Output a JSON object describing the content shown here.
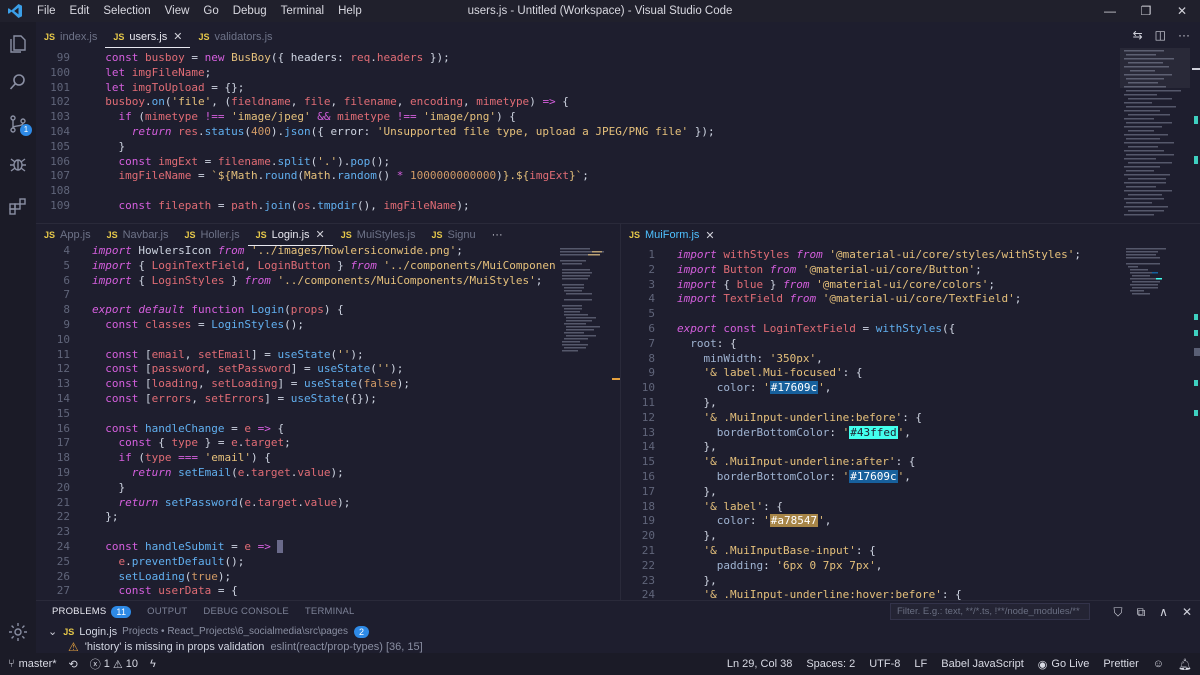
{
  "window": {
    "title": "users.js - Untitled (Workspace) - Visual Studio Code",
    "menu": [
      "File",
      "Edit",
      "Selection",
      "View",
      "Go",
      "Debug",
      "Terminal",
      "Help"
    ]
  },
  "activity_bar": {
    "icons": [
      "files-icon",
      "search-icon",
      "source-control-icon",
      "debug-icon",
      "extensions-icon",
      "settings-gear-icon"
    ],
    "scm_badge": "1"
  },
  "top_editor": {
    "tabs": [
      {
        "label": "index.js",
        "active": false
      },
      {
        "label": "users.js",
        "active": true
      },
      {
        "label": "validators.js",
        "active": false
      }
    ],
    "lines": [
      {
        "n": "99",
        "html": "  <span class='kw'>const</span> <span class='var'>busboy</span> <span class='plain'>=</span> <span class='kw'>new</span> <span class='cls'>BusBoy</span><span class='plain'>({ headers: </span><span class='var'>req</span><span class='plain'>.</span><span class='var'>headers</span><span class='plain'> });</span>"
      },
      {
        "n": "100",
        "html": "  <span class='kw'>let</span> <span class='var'>imgFileName</span><span class='plain'>;</span>"
      },
      {
        "n": "101",
        "html": "  <span class='kw'>let</span> <span class='var'>imgToUpload</span> <span class='plain'>= {};</span>"
      },
      {
        "n": "102",
        "html": "  <span class='var'>busboy</span><span class='plain'>.</span><span class='fn'>on</span><span class='plain'>(</span><span class='str'>'file'</span><span class='plain'>, (</span><span class='var'>fieldname</span><span class='plain'>, </span><span class='var'>file</span><span class='plain'>, </span><span class='var'>filename</span><span class='plain'>, </span><span class='var'>encoding</span><span class='plain'>, </span><span class='var'>mimetype</span><span class='plain'>) </span><span class='kw'>=></span><span class='plain'> {</span>"
      },
      {
        "n": "103",
        "html": "    <span class='kw'>if</span><span class='plain'> (</span><span class='var'>mimetype</span> <span class='kw'>!==</span> <span class='str'>'image/jpeg'</span> <span class='kw'>&&</span> <span class='var'>mimetype</span> <span class='kw'>!==</span> <span class='str'>'image/png'</span><span class='plain'>) {</span>"
      },
      {
        "n": "104",
        "html": "      <span class='kw ital'>return</span> <span class='var'>res</span><span class='plain'>.</span><span class='fn'>status</span><span class='plain'>(</span><span class='num'>400</span><span class='plain'>).</span><span class='fn'>json</span><span class='plain'>({ error: </span><span class='str'>'Unsupported file type, upload a JPEG/PNG file'</span><span class='plain'> });</span>"
      },
      {
        "n": "105",
        "html": "    <span class='plain'>}</span>"
      },
      {
        "n": "106",
        "html": "    <span class='kw'>const</span> <span class='var'>imgExt</span> <span class='plain'>=</span> <span class='var'>filename</span><span class='plain'>.</span><span class='fn'>split</span><span class='plain'>(</span><span class='str'>'.'</span><span class='plain'>).</span><span class='fn'>pop</span><span class='plain'>();</span>"
      },
      {
        "n": "107",
        "html": "    <span class='var'>imgFileName</span> <span class='plain'>=</span> <span class='str'>`${</span><span class='cls'>Math</span><span class='plain'>.</span><span class='fn'>round</span><span class='plain'>(</span><span class='cls'>Math</span><span class='plain'>.</span><span class='fn'>random</span><span class='plain'>() </span><span class='kw'>*</span> <span class='num'>1000000000000</span><span class='plain'>)</span><span class='str'>}.${</span><span class='var'>imgExt</span><span class='str'>}`</span><span class='plain'>;</span>"
      },
      {
        "n": "108",
        "html": ""
      },
      {
        "n": "109",
        "html": "    <span class='kw'>const</span> <span class='var'>filepath</span> <span class='plain'>=</span> <span class='var'>path</span><span class='plain'>.</span><span class='fn'>join</span><span class='plain'>(</span><span class='var'>os</span><span class='plain'>.</span><span class='fn'>tmpdir</span><span class='plain'>(), </span><span class='var'>imgFileName</span><span class='plain'>);</span>"
      }
    ]
  },
  "left_editor": {
    "tabs": [
      {
        "label": "App.js",
        "active": false
      },
      {
        "label": "Navbar.js",
        "active": false
      },
      {
        "label": "Holler.js",
        "active": false
      },
      {
        "label": "Login.js",
        "active": true
      },
      {
        "label": "MuiStyles.js",
        "active": false
      },
      {
        "label": "Signu",
        "active": false
      }
    ],
    "more": "···",
    "lines": [
      {
        "n": "4",
        "html": "<span class='kw ital'>import</span> <span class='plain'>HowlersIcon</span> <span class='kw ital'>from</span> <span class='str'>'../images/howlersiconwide.png'</span><span class='plain'>;</span>"
      },
      {
        "n": "5",
        "html": "<span class='kw ital'>import</span> <span class='plain'>{ </span><span class='var'>LoginTextField</span><span class='plain'>, </span><span class='var'>LoginButton</span><span class='plain'> } </span><span class='kw ital'>from</span> <span class='str'>'../components/MuiComponents/MuiF</span>"
      },
      {
        "n": "6",
        "html": "<span class='kw ital'>import</span> <span class='plain'>{ </span><span class='var'>LoginStyles</span><span class='plain'> } </span><span class='kw ital'>from</span> <span class='str'>'../components/MuiComponents/MuiStyles'</span><span class='plain'>;</span>"
      },
      {
        "n": "7",
        "html": ""
      },
      {
        "n": "8",
        "html": "<span class='kw ital'>export default</span> <span class='kw'>function</span> <span class='fn'>Login</span><span class='plain'>(</span><span class='var'>props</span><span class='plain'>) {</span>"
      },
      {
        "n": "9",
        "html": "  <span class='kw'>const</span> <span class='var'>classes</span> <span class='plain'>=</span> <span class='fn'>LoginStyles</span><span class='plain'>();</span>"
      },
      {
        "n": "10",
        "html": ""
      },
      {
        "n": "11",
        "html": "  <span class='kw'>const</span> <span class='plain'>[</span><span class='var'>email</span><span class='plain'>, </span><span class='var'>setEmail</span><span class='plain'>] =</span> <span class='fn'>useState</span><span class='plain'>(</span><span class='str'>''</span><span class='plain'>);</span>"
      },
      {
        "n": "12",
        "html": "  <span class='kw'>const</span> <span class='plain'>[</span><span class='var'>password</span><span class='plain'>, </span><span class='var'>setPassword</span><span class='plain'>] =</span> <span class='fn'>useState</span><span class='plain'>(</span><span class='str'>''</span><span class='plain'>);</span>"
      },
      {
        "n": "13",
        "html": "  <span class='kw'>const</span> <span class='plain'>[</span><span class='var'>loading</span><span class='plain'>, </span><span class='var'>setLoading</span><span class='plain'>] =</span> <span class='fn'>useState</span><span class='plain'>(</span><span class='num'>false</span><span class='plain'>);</span>"
      },
      {
        "n": "14",
        "html": "  <span class='kw'>const</span> <span class='plain'>[</span><span class='var'>errors</span><span class='plain'>, </span><span class='var'>setErrors</span><span class='plain'>] =</span> <span class='fn'>useState</span><span class='plain'>({});</span>"
      },
      {
        "n": "15",
        "html": ""
      },
      {
        "n": "16",
        "html": "  <span class='kw'>const</span> <span class='fn'>handleChange</span> <span class='plain'>=</span> <span class='var'>e</span> <span class='kw'>=></span><span class='plain'> {</span>"
      },
      {
        "n": "17",
        "html": "    <span class='kw'>const</span> <span class='plain'>{ </span><span class='var'>type</span><span class='plain'> } =</span> <span class='var'>e</span><span class='plain'>.</span><span class='var'>target</span><span class='plain'>;</span>"
      },
      {
        "n": "18",
        "html": "    <span class='kw'>if</span><span class='plain'> (</span><span class='var'>type</span> <span class='kw'>===</span> <span class='str'>'email'</span><span class='plain'>) {</span>"
      },
      {
        "n": "19",
        "html": "      <span class='kw ital'>return</span> <span class='fn'>setEmail</span><span class='plain'>(</span><span class='var'>e</span><span class='plain'>.</span><span class='var'>target</span><span class='plain'>.</span><span class='var'>value</span><span class='plain'>);</span>"
      },
      {
        "n": "20",
        "html": "    <span class='plain'>}</span>"
      },
      {
        "n": "21",
        "html": "    <span class='kw ital'>return</span> <span class='fn'>setPassword</span><span class='plain'>(</span><span class='var'>e</span><span class='plain'>.</span><span class='var'>target</span><span class='plain'>.</span><span class='var'>value</span><span class='plain'>);</span>"
      },
      {
        "n": "22",
        "html": "  <span class='plain'>};</span>"
      },
      {
        "n": "23",
        "html": ""
      },
      {
        "n": "24",
        "html": "  <span class='kw'>const</span> <span class='fn'>handleSubmit</span> <span class='plain'>=</span> <span class='var'>e</span> <span class='kw'>=></span> <span class='cursor'></span>"
      },
      {
        "n": "25",
        "html": "    <span class='var'>e</span><span class='plain'>.</span><span class='fn'>preventDefault</span><span class='plain'>();</span>"
      },
      {
        "n": "26",
        "html": "    <span class='fn'>setLoading</span><span class='plain'>(</span><span class='num'>true</span><span class='plain'>);</span>"
      },
      {
        "n": "27",
        "html": "    <span class='kw'>const</span> <span class='var'>userData</span> <span class='plain'>= {</span>"
      }
    ]
  },
  "right_editor": {
    "tabs": [
      {
        "label": "MuiForm.js",
        "active": true
      }
    ],
    "lines": [
      {
        "n": "1",
        "html": "<span class='kw ital'>import</span> <span class='var'>withStyles</span> <span class='kw ital'>from</span> <span class='str'>'@material-ui/core/styles/withStyles'</span><span class='plain'>;</span>"
      },
      {
        "n": "2",
        "html": "<span class='kw ital'>import</span> <span class='var'>Button</span> <span class='kw ital'>from</span> <span class='str'>'@material-ui/core/Button'</span><span class='plain'>;</span>"
      },
      {
        "n": "3",
        "html": "<span class='kw ital'>import</span> <span class='plain'>{ </span><span class='var'>blue</span><span class='plain'> } </span><span class='kw ital'>from</span> <span class='str'>'@material-ui/core/colors'</span><span class='plain'>;</span>"
      },
      {
        "n": "4",
        "html": "<span class='kw ital'>import</span> <span class='var'>TextField</span> <span class='kw ital'>from</span> <span class='str'>'@material-ui/core/TextField'</span><span class='plain'>;</span>"
      },
      {
        "n": "5",
        "html": ""
      },
      {
        "n": "6",
        "html": "<span class='kw ital'>export</span> <span class='kw'>const</span> <span class='var'>LoginTextField</span> <span class='plain'>=</span> <span class='fn'>withStyles</span><span class='plain'>({</span>"
      },
      {
        "n": "7",
        "html": "  <span class='prop'>root</span><span class='plain'>: {</span>"
      },
      {
        "n": "8",
        "html": "    <span class='prop'>minWidth</span><span class='plain'>: </span><span class='str'>'350px'</span><span class='plain'>,</span>"
      },
      {
        "n": "9",
        "html": "    <span class='str'>'&amp; label.Mui-focused'</span><span class='plain'>: {</span>"
      },
      {
        "n": "10",
        "html": "      <span class='prop'>color</span><span class='plain'>: </span><span class='str'>'</span><span class='swatch' style='background:#17609c'>#17609c</span><span class='str'>'</span><span class='plain'>,</span>"
      },
      {
        "n": "11",
        "html": "    <span class='plain'>},</span>"
      },
      {
        "n": "12",
        "html": "    <span class='str'>'&amp; .MuiInput-underline:before'</span><span class='plain'>: {</span>"
      },
      {
        "n": "13",
        "html": "      <span class='prop'>borderBottomColor</span><span class='plain'>: </span><span class='str'>'</span><span class='swatch' style='background:#43ffed;color:#1e1e2e'>#43ffed</span><span class='str'>'</span><span class='plain'>,</span>"
      },
      {
        "n": "14",
        "html": "    <span class='plain'>},</span>"
      },
      {
        "n": "15",
        "html": "    <span class='str'>'&amp; .MuiInput-underline:after'</span><span class='plain'>: {</span>"
      },
      {
        "n": "16",
        "html": "      <span class='prop'>borderBottomColor</span><span class='plain'>: </span><span class='str'>'</span><span class='swatch' style='background:#17609c'>#17609c</span><span class='str'>'</span><span class='plain'>,</span>"
      },
      {
        "n": "17",
        "html": "    <span class='plain'>},</span>"
      },
      {
        "n": "18",
        "html": "    <span class='str'>'&amp; label'</span><span class='plain'>: {</span>"
      },
      {
        "n": "19",
        "html": "      <span class='prop'>color</span><span class='plain'>: </span><span class='str'>'</span><span class='swatch' style='background:#a78547'>#a78547</span><span class='str'>'</span><span class='plain'>,</span>"
      },
      {
        "n": "20",
        "html": "    <span class='plain'>},</span>"
      },
      {
        "n": "21",
        "html": "    <span class='str'>'&amp; .MuiInputBase-input'</span><span class='plain'>: {</span>"
      },
      {
        "n": "22",
        "html": "      <span class='prop'>padding</span><span class='plain'>: </span><span class='str'>'6px 0 7px 7px'</span><span class='plain'>,</span>"
      },
      {
        "n": "23",
        "html": "    <span class='plain'>},</span>"
      },
      {
        "n": "24",
        "html": "    <span class='str'>'&amp; .MuiInput-underline:hover:before'</span><span class='plain'>: {</span>"
      }
    ]
  },
  "panel": {
    "tabs": [
      {
        "label": "PROBLEMS",
        "active": true,
        "count": "11"
      },
      {
        "label": "OUTPUT",
        "active": false
      },
      {
        "label": "DEBUG CONSOLE",
        "active": false
      },
      {
        "label": "TERMINAL",
        "active": false
      }
    ],
    "filter_placeholder": "Filter. E.g.: text, **/*.ts, !**/node_modules/**",
    "problem_file": "Login.js",
    "problem_path": "Projects • React_Projects\\6_socialmedia\\src\\pages",
    "problem_count": "2",
    "problem_message": "'history' is missing in props validation",
    "problem_source": "eslint(react/prop-types)  [36, 15]"
  },
  "statusbar": {
    "branch": "master*",
    "errors": "1",
    "warnings": "10",
    "position": "Ln 29, Col 38",
    "spaces": "Spaces: 2",
    "encoding": "UTF-8",
    "eol": "LF",
    "language": "Babel JavaScript",
    "golive": "Go Live",
    "prettier": "Prettier"
  },
  "colors": {
    "accent": "#2e8ae6",
    "warning": "#e5a13e"
  }
}
